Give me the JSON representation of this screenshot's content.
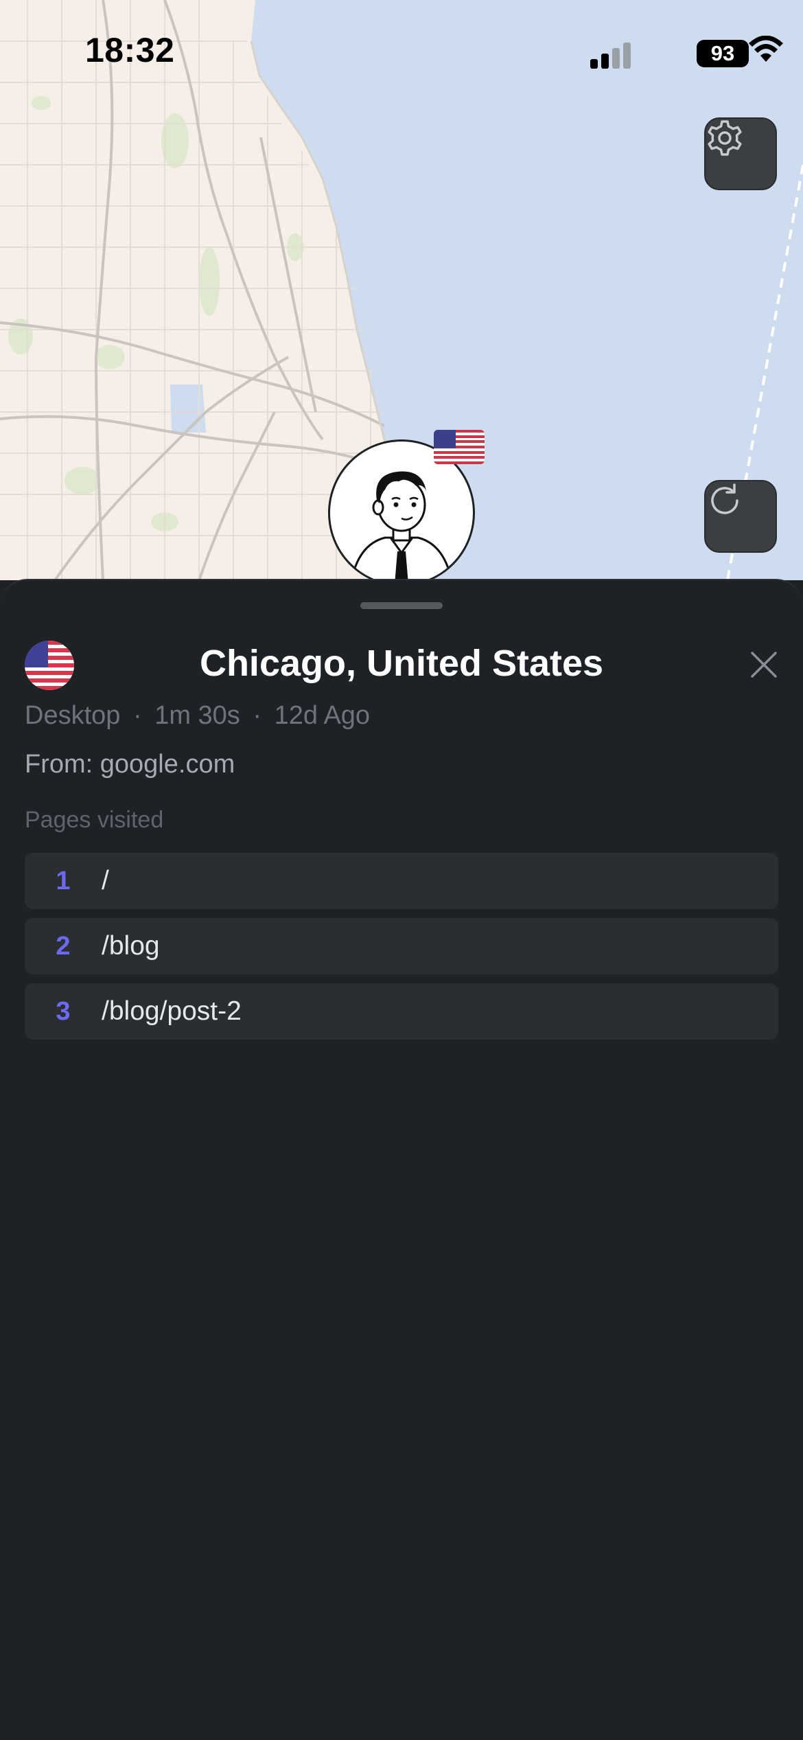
{
  "status_bar": {
    "time": "18:32",
    "battery": "93",
    "icons": [
      "signal-icon",
      "wifi-icon",
      "battery-icon"
    ]
  },
  "map": {
    "buttons": [
      {
        "name": "settings",
        "icon": "gear-icon"
      },
      {
        "name": "refresh",
        "icon": "refresh-icon"
      }
    ],
    "marker": {
      "avatar": "avatar-icon",
      "flag": "us-flag-icon"
    },
    "colors": {
      "land": "#f6efe8",
      "water": "#cddcee",
      "road": "#c9c4bf"
    }
  },
  "sheet": {
    "title": "Chicago, United States",
    "country_flag": "us-flag-icon",
    "meta": {
      "device": "Desktop",
      "duration": "1m 30s",
      "ago": "12d Ago"
    },
    "separator": "·",
    "from": "From: google.com",
    "pages_label": "Pages visited",
    "pages": [
      {
        "index": "1",
        "path": "/"
      },
      {
        "index": "2",
        "path": "/blog"
      },
      {
        "index": "3",
        "path": "/blog/post-2"
      }
    ],
    "colors": {
      "background": "#1e2125",
      "row": "#2a2d32",
      "accent": "#6d6af0"
    }
  }
}
